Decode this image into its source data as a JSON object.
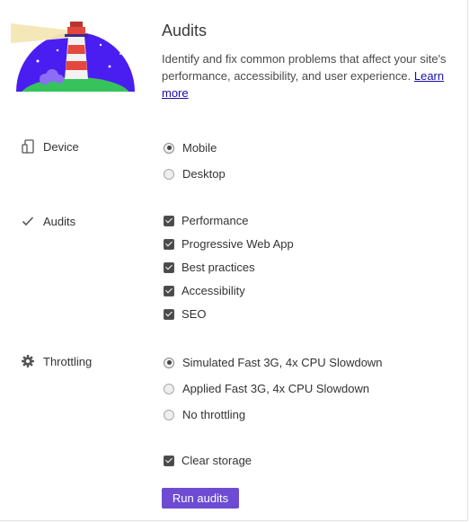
{
  "header": {
    "title": "Audits",
    "description": "Identify and fix common problems that affect your site's performance, accessibility, and user experience.",
    "learn_more": "Learn more"
  },
  "device": {
    "label": "Device",
    "icon": "mobile-device-icon",
    "options": [
      {
        "label": "Mobile",
        "selected": true
      },
      {
        "label": "Desktop",
        "selected": false
      }
    ]
  },
  "audits": {
    "label": "Audits",
    "icon": "checkmark-icon",
    "options": [
      {
        "label": "Performance",
        "checked": true
      },
      {
        "label": "Progressive Web App",
        "checked": true
      },
      {
        "label": "Best practices",
        "checked": true
      },
      {
        "label": "Accessibility",
        "checked": true
      },
      {
        "label": "SEO",
        "checked": true
      }
    ]
  },
  "throttling": {
    "label": "Throttling",
    "icon": "gear-icon",
    "options": [
      {
        "label": "Simulated Fast 3G, 4x CPU Slowdown",
        "selected": true
      },
      {
        "label": "Applied Fast 3G, 4x CPU Slowdown",
        "selected": false
      },
      {
        "label": "No throttling",
        "selected": false
      }
    ]
  },
  "clear_storage": {
    "label": "Clear storage",
    "checked": true
  },
  "run_button": {
    "label": "Run audits"
  },
  "colors": {
    "accent": "#6d4bd3",
    "link": "#1a0dab"
  }
}
